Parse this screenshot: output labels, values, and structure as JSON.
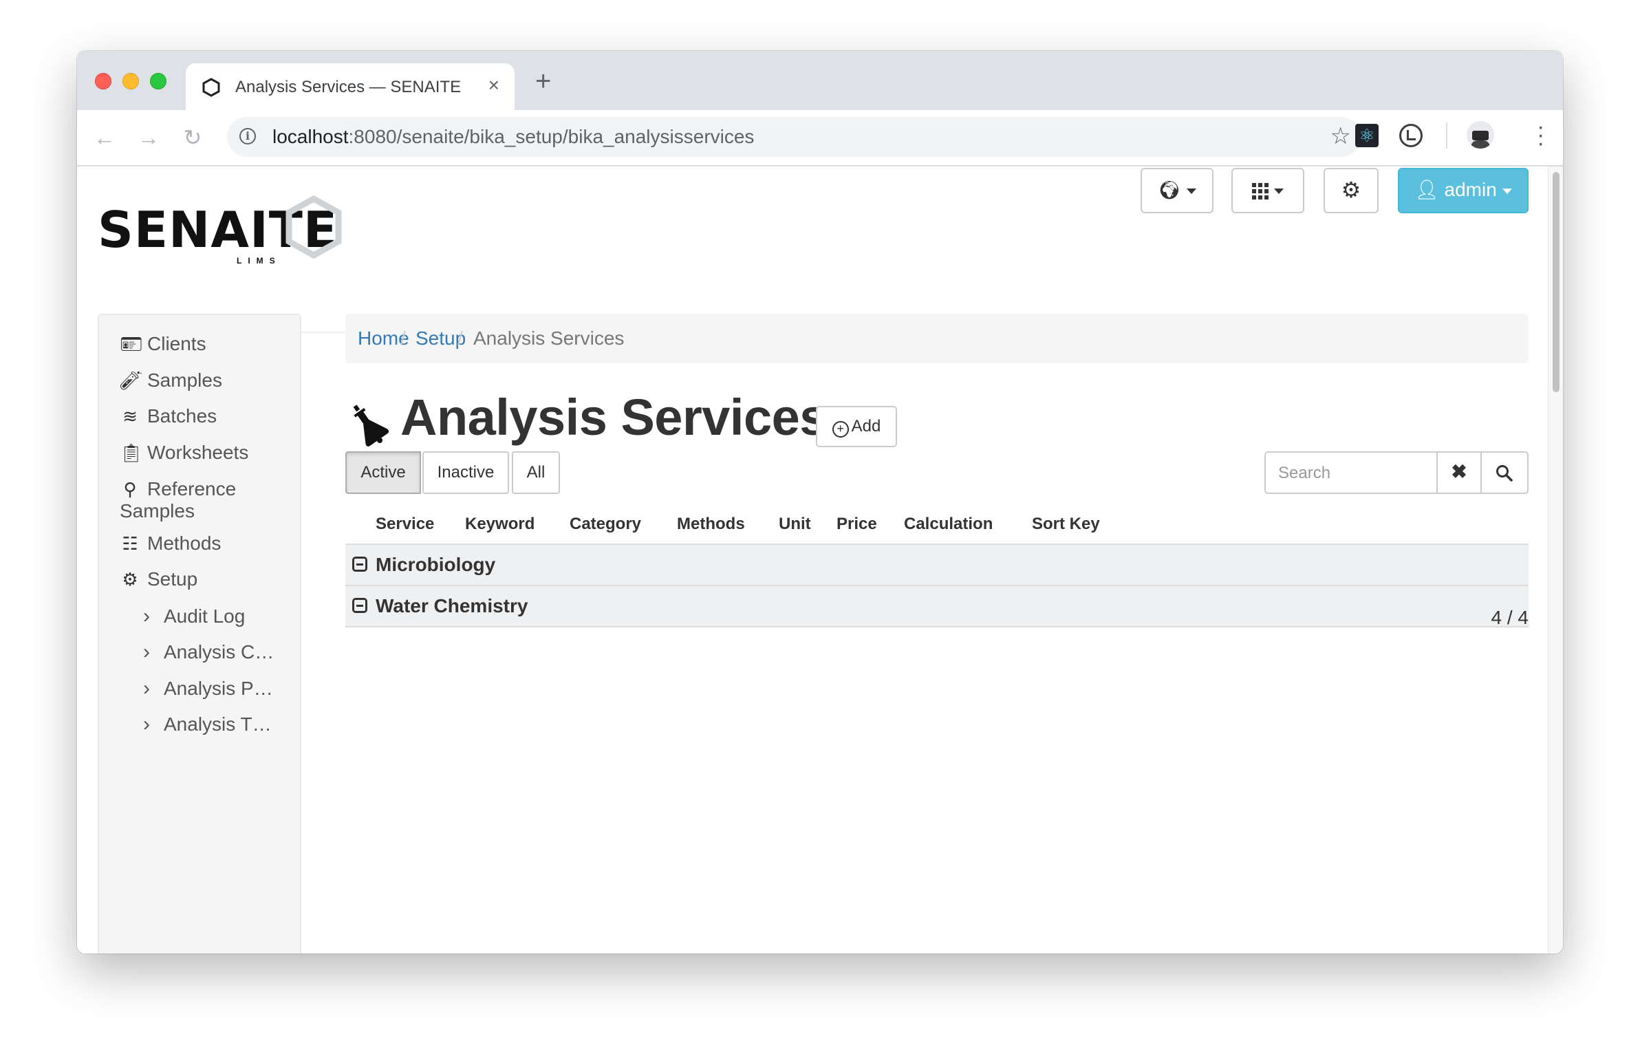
{
  "browser": {
    "tab_title": "Analysis Services — SENAITE",
    "url_host": "localhost",
    "url_rest": ":8080/senaite/bika_setup/bika_analysisservices"
  },
  "header": {
    "logo_text": "SENAITE",
    "logo_sub": "LIMS",
    "admin_label": "admin"
  },
  "sidebar": {
    "items": [
      {
        "label": "Clients",
        "icon": "contact-card-icon"
      },
      {
        "label": "Samples",
        "icon": "test-tubes-icon"
      },
      {
        "label": "Batches",
        "icon": "layers-icon"
      },
      {
        "label": "Worksheets",
        "icon": "clipboard-clock-icon"
      },
      {
        "label_line1": "Reference",
        "label_line2": "Samples",
        "icon": "reference-icon"
      },
      {
        "label": "Methods",
        "icon": "checklist-icon"
      },
      {
        "label": "Setup",
        "icon": "gears-icon"
      }
    ],
    "sub_items": [
      "Audit Log",
      "Analysis C…",
      "Analysis P…",
      "Analysis T…"
    ]
  },
  "breadcrumb": {
    "home": "Home",
    "setup": "Setup",
    "current": "Analysis Services",
    "separator": "/"
  },
  "main": {
    "title": "Analysis Services",
    "add_label": "Add",
    "filters": [
      "Active",
      "Inactive",
      "All"
    ],
    "active_filter": "Active",
    "search_placeholder": "Search",
    "columns": [
      "Service",
      "Keyword",
      "Category",
      "Methods",
      "Unit",
      "Price",
      "Calculation",
      "Sort Key"
    ],
    "categories": [
      "Microbiology",
      "Water Chemistry"
    ],
    "count_text": "4 / 4"
  },
  "colors": {
    "link": "#337ab7",
    "admin_button": "#5bc0de",
    "category_row": "#eef0f2"
  }
}
